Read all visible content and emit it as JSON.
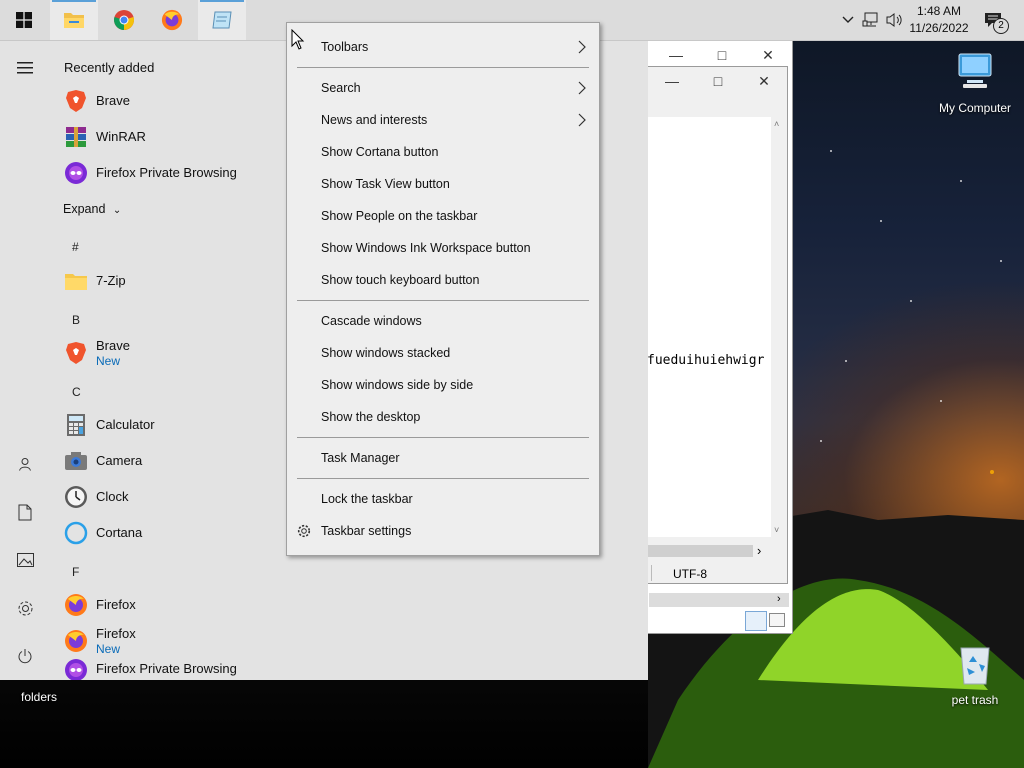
{
  "taskbar": {
    "apps": [
      {
        "name": "start-button"
      },
      {
        "name": "file-explorer"
      },
      {
        "name": "google-chrome"
      },
      {
        "name": "firefox"
      },
      {
        "name": "notepad"
      }
    ],
    "tray": {
      "time": "1:48 AM",
      "date": "11/26/2022",
      "notification_count": "2"
    }
  },
  "start_menu": {
    "recently_added_label": "Recently added",
    "recent": [
      {
        "label": "Brave",
        "icon": "brave-icon"
      },
      {
        "label": "WinRAR",
        "icon": "winrar-icon"
      },
      {
        "label": "Firefox Private Browsing",
        "icon": "firefox-private-icon"
      }
    ],
    "expand_label": "Expand",
    "letters": {
      "hash": "#",
      "b": "B",
      "c": "C",
      "f": "F"
    },
    "apps": {
      "zip": {
        "label": "7-Zip"
      },
      "brave": {
        "label": "Brave",
        "sub": "New"
      },
      "calculator": {
        "label": "Calculator"
      },
      "camera": {
        "label": "Camera"
      },
      "clock": {
        "label": "Clock"
      },
      "cortana": {
        "label": "Cortana"
      },
      "firefox": {
        "label": "Firefox"
      },
      "firefox_new": {
        "label": "Firefox",
        "sub": "New"
      },
      "firefox_private": {
        "label": "Firefox Private Browsing"
      }
    }
  },
  "notepad": {
    "text_fragment": "fueduihuiehwigr",
    "encoding": "UTF-8"
  },
  "context_menu": {
    "items": {
      "toolbars": "Toolbars",
      "search": "Search",
      "news": "News and interests",
      "cortana": "Show Cortana button",
      "task_view": "Show Task View button",
      "people": "Show People on the taskbar",
      "ink": "Show Windows Ink Workspace button",
      "touch_keyboard": "Show touch keyboard button",
      "cascade": "Cascade windows",
      "stacked": "Show windows stacked",
      "side_by_side": "Show windows side by side",
      "desktop": "Show the desktop",
      "task_manager": "Task Manager",
      "lock": "Lock the taskbar",
      "settings": "Taskbar settings"
    }
  },
  "desktop": {
    "my_computer": "My Computer",
    "folders": "folders",
    "pet_trash": "pet trash"
  },
  "colors": {
    "accent": "#0a6bb8",
    "taskbar": "#dcdcdc",
    "start_bg": "#e3e3e3",
    "menu_bg": "#eeeeee"
  }
}
